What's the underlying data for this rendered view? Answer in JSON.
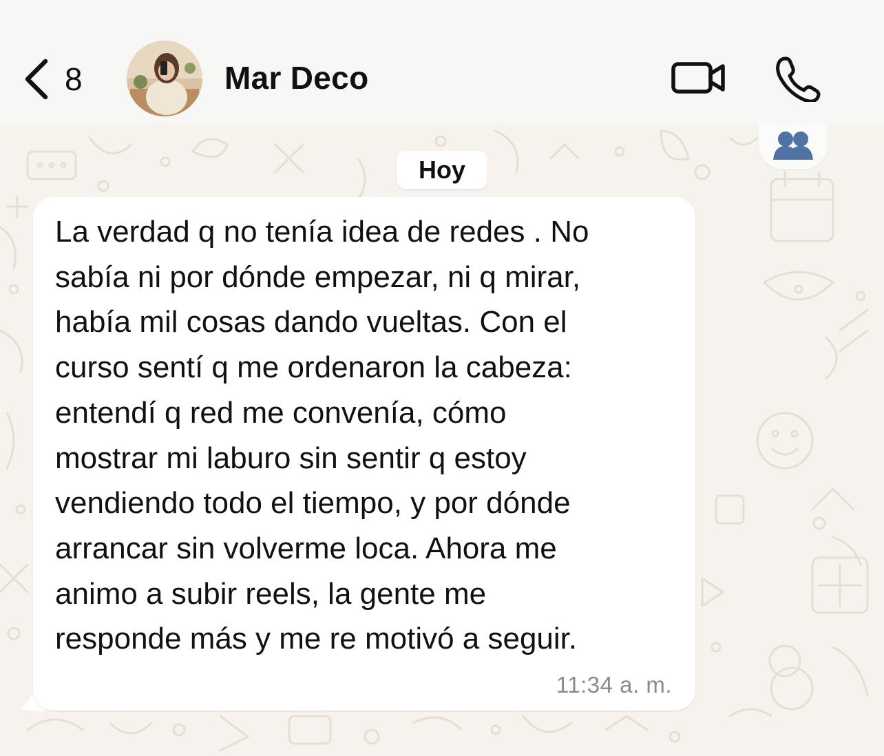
{
  "header": {
    "back_count": "8",
    "contact_name": "Mar Deco"
  },
  "chat": {
    "date_label": "Hoy",
    "messages": [
      {
        "direction": "incoming",
        "text": "La verdad q no tenía idea de redes . No\nsabía ni por dónde empezar, ni q mirar,\nhabía mil cosas dando vueltas. Con el\ncurso sentí q me ordenaron la cabeza:\nentendí q red me convenía, cómo\nmostrar mi laburo sin sentir q estoy\nvendiendo todo el tiempo, y por dónde\narrancar sin volverme loca. Ahora me\nanimo a subir reels, la gente me\nresponde más y me re motivó a seguir.",
        "time": "11:34 a. m."
      }
    ]
  },
  "icons": {
    "back": "chevron-left-icon",
    "video": "video-camera-icon",
    "call": "phone-icon",
    "group": "group-icon"
  },
  "colors": {
    "header_bg": "#f7f7f5",
    "wallpaper_bg": "#f6f3ee",
    "bubble_bg": "#ffffff",
    "time_text": "#8a8a8a",
    "group_icon": "#4f73a3"
  }
}
